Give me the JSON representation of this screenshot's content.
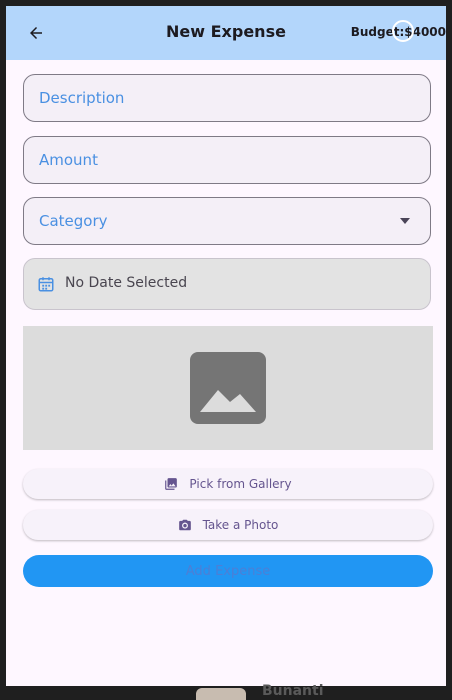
{
  "appbar": {
    "title": "New Expense",
    "budget": "Budget:$4000"
  },
  "form": {
    "description_label": "Description",
    "amount_label": "Amount",
    "category_label": "Category",
    "date_text": "No Date Selected"
  },
  "actions": {
    "gallery_label": "Pick from Gallery",
    "photo_label": "Take a Photo",
    "submit_label": "Add Expense"
  },
  "background": {
    "partial_text": "Bunanti"
  },
  "icons": {
    "back": "arrow-back-icon",
    "calendar": "calendar-icon",
    "image_placeholder": "image-icon",
    "gallery": "photo-library-icon",
    "camera": "camera-icon",
    "dropdown": "arrow-drop-down-icon"
  },
  "colors": {
    "appbar": "#b3d6fb",
    "page": "#fef7ff",
    "label": "#4a90e2",
    "button_text": "#65558f",
    "primary_button": "#2196f3"
  }
}
